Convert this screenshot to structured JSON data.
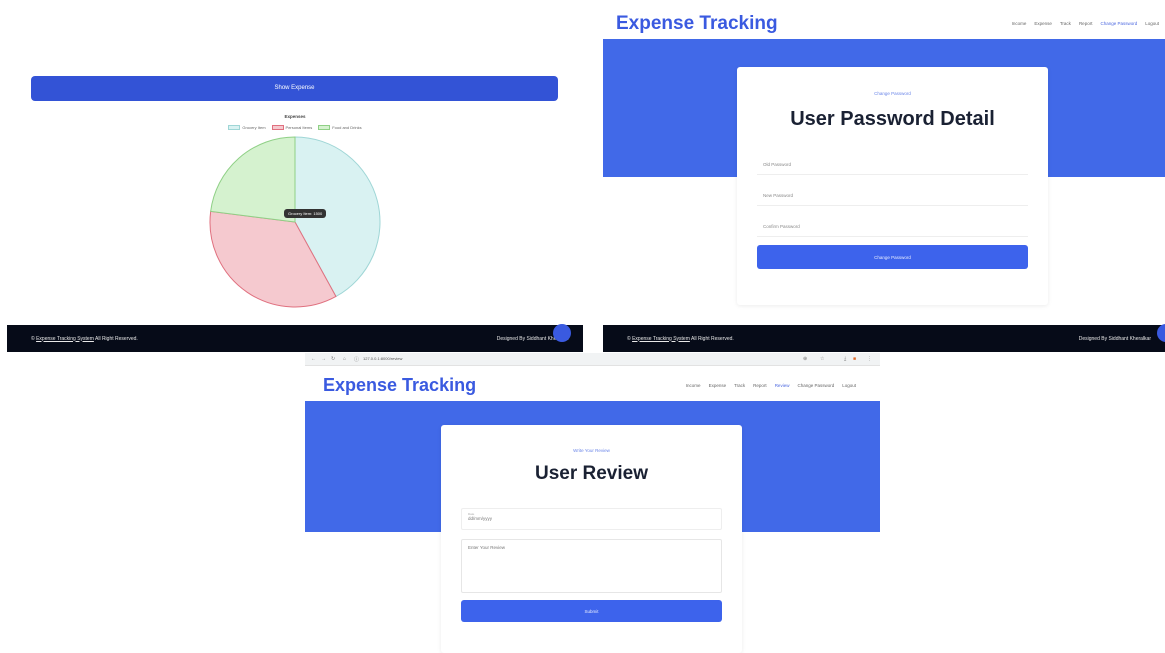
{
  "panel_expenses": {
    "show_button_label": "Show Expense",
    "chart_title": "Expenses",
    "legend": [
      {
        "label": "Grocery Item",
        "color": "#d9f2f2",
        "border": "#9fd6d6"
      },
      {
        "label": "Personal Items",
        "color": "#f5c9cf",
        "border": "#e0707f"
      },
      {
        "label": "Food and Drinks",
        "color": "#d5f2cf",
        "border": "#8fd086"
      }
    ],
    "tooltip": "Grocery Item: 1500",
    "footer_copyright_prefix": "© ",
    "footer_copyright_link": "Expense Tracking System",
    "footer_copyright_suffix": " All Right Reserved.",
    "footer_designed": "Designed By Siddhant Kheralkar"
  },
  "chart_data": {
    "type": "pie",
    "title": "Expenses",
    "categories": [
      "Grocery Item",
      "Personal Items",
      "Food and Drinks"
    ],
    "values": [
      42,
      35,
      23
    ],
    "colors": [
      "#d9f2f2",
      "#f5c9cf",
      "#d5f2cf"
    ],
    "borders": [
      "#9fd6d6",
      "#e0707f",
      "#8fd086"
    ],
    "legend_position": "top"
  },
  "panel_password": {
    "brand": "Expense Tracking",
    "nav": [
      "Income",
      "Expense",
      "Track",
      "Report",
      "Change Password",
      "Logout"
    ],
    "active_nav": "Change Password",
    "card_subtitle": "Change Password",
    "card_title": "User Password Detail",
    "fields": [
      "Old Password",
      "New Password",
      "Confirm Password"
    ],
    "button_label": "Change Password",
    "footer_copyright_prefix": "© ",
    "footer_copyright_link": "Expense Tracking System",
    "footer_copyright_suffix": " All Right Reserved.",
    "footer_designed": "Designed By Siddhant Kheralkar"
  },
  "panel_review": {
    "url": "127.0.0.1:8000/review",
    "brand": "Expense Tracking",
    "nav": [
      "Income",
      "Expense",
      "Track",
      "Report",
      "Review",
      "Change Password",
      "Logout"
    ],
    "active_nav": "Review",
    "card_subtitle": "Write Your Review",
    "card_title": "User Review",
    "date_label": "Date",
    "date_value": "dd/mm/yyyy",
    "review_placeholder": "Enter Your Review",
    "button_label": "Submit"
  }
}
